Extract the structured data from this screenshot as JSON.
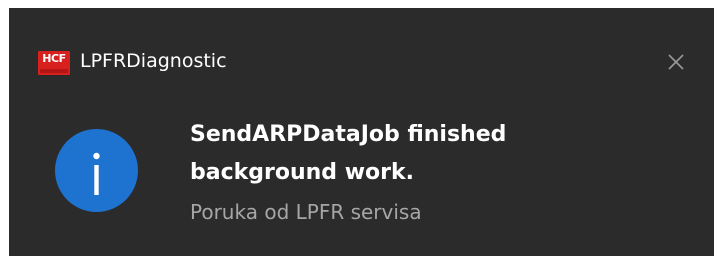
{
  "app": {
    "name": "LPFRDiagnostic",
    "logo_text": "HCF"
  },
  "notification": {
    "title_line1": "SendARPDataJob finished",
    "title_line2": "background work.",
    "body": "Poruka od LPFR servisa"
  },
  "icons": {
    "app_logo": "hcf-logo",
    "info": "info-icon",
    "close": "close-icon"
  },
  "colors": {
    "toast_background": "#2b2b2b",
    "info_icon": "#1e72d0",
    "logo": "#d8201f",
    "secondary_text": "#a6a6a6"
  }
}
